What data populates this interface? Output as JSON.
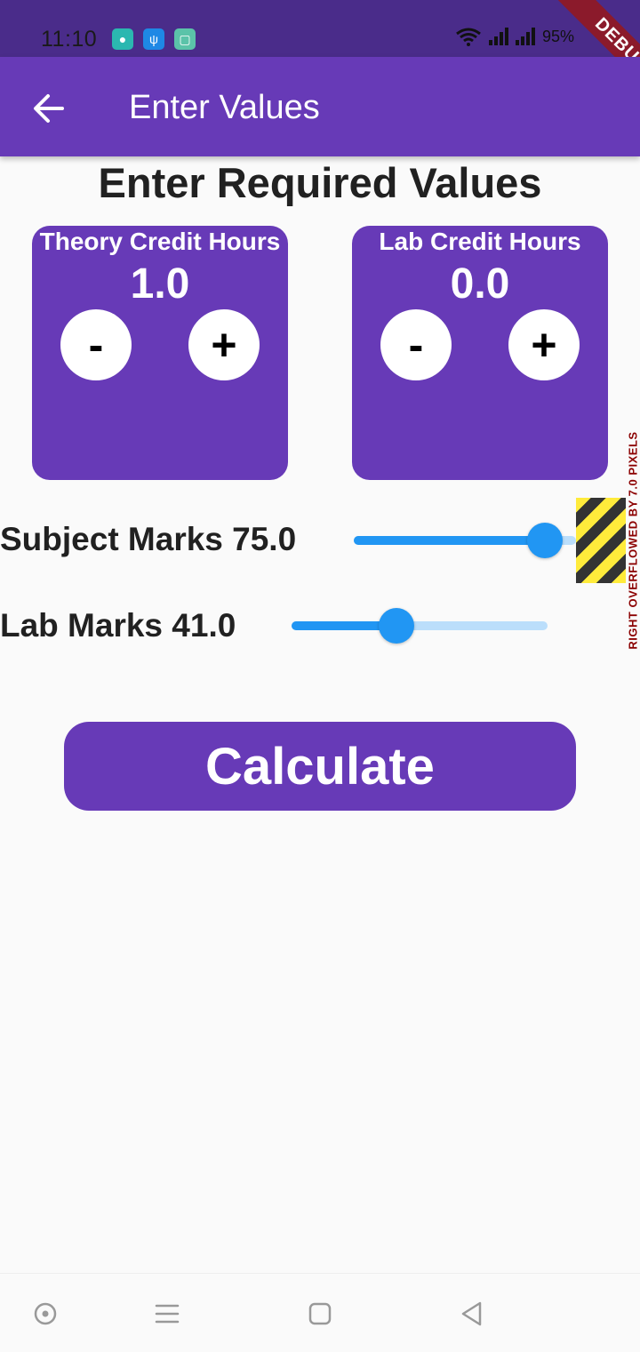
{
  "status_bar": {
    "time": "11:10",
    "battery": "95%",
    "app_icons": [
      "chat-bubble-icon",
      "usb-icon",
      "gallery-icon"
    ]
  },
  "debug_banner": "DEBUG",
  "app_bar": {
    "title": "Enter Values",
    "back_icon": "arrow-left-icon",
    "color": "#673AB7"
  },
  "heading": "Enter Required Values",
  "cards": {
    "theory": {
      "title": "Theory Credit Hours",
      "value": "1.0",
      "minus": "-",
      "plus": "+"
    },
    "lab": {
      "title": "Lab Credit Hours",
      "value": "0.0",
      "minus": "-",
      "plus": "+"
    }
  },
  "sliders": {
    "subject": {
      "label": "Subject Marks 75.0",
      "value": 75.0,
      "fraction": 0.86
    },
    "lab": {
      "label": "Lab Marks 41.0",
      "value": 41.0,
      "fraction": 0.41
    }
  },
  "overflow_warning": "RIGHT OVERFLOWED BY 7.0 PIXELS",
  "calculate_button": "Calculate",
  "colors": {
    "accent": "#673AB7",
    "slider": "#2196F3",
    "slider_track": "#BBDEFB"
  }
}
